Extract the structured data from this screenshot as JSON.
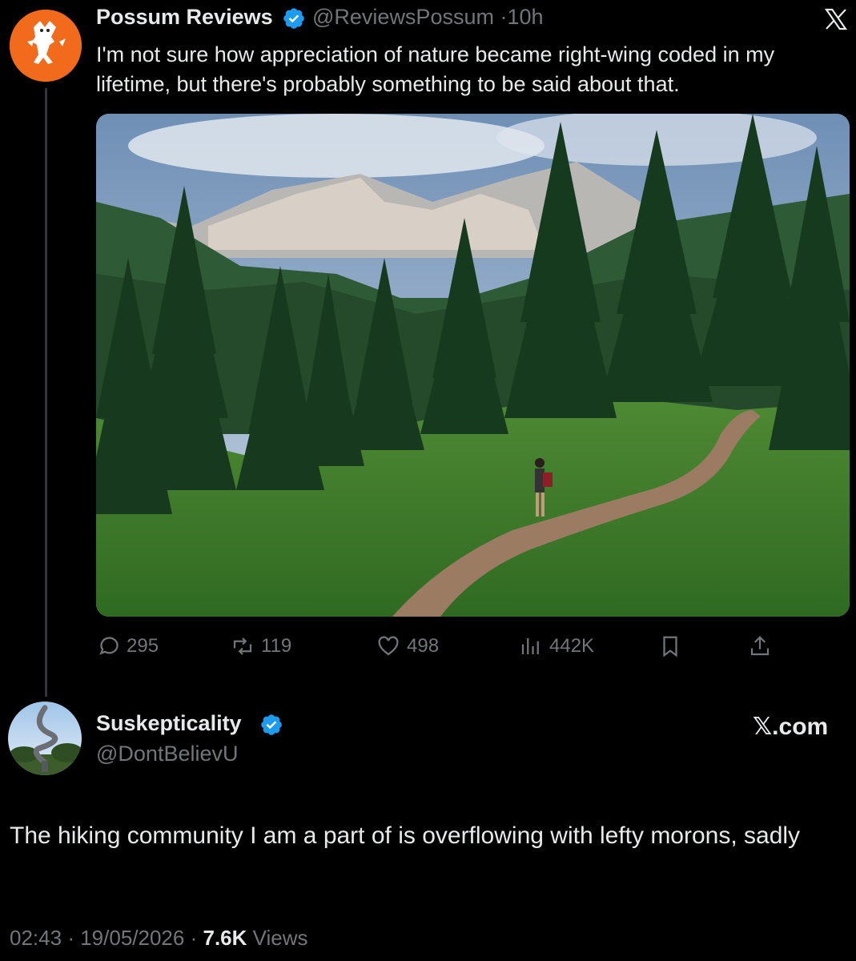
{
  "quoted_tweet": {
    "author_name": "Possum Reviews",
    "author_handle": "@ReviewsPossum",
    "separator": "·",
    "time_ago": "10h",
    "text": "I'm not sure how appreciation of nature became right-wing coded in my lifetime, but there's probably something to be said about that.",
    "image_icon": "hiking-trail-photo",
    "actions": {
      "replies": "295",
      "reposts": "119",
      "likes": "498",
      "views": "442K"
    }
  },
  "reply_tweet": {
    "author_name": "Suskepticality",
    "author_handle": "@DontBelievU",
    "brand_label": "𝕏.com",
    "text": "The hiking community I am a part of is overflowing with lefty morons, sadly",
    "time": "02:43",
    "date": "19/05/2026",
    "views_count": "7.6K",
    "views_label": "Views",
    "separator": "·"
  },
  "colors": {
    "background": "#000000",
    "text_primary": "#e7e9ea",
    "text_secondary": "#71767b",
    "verified_blue": "#1d9bf0",
    "avatar_orange": "#f26a1b"
  }
}
